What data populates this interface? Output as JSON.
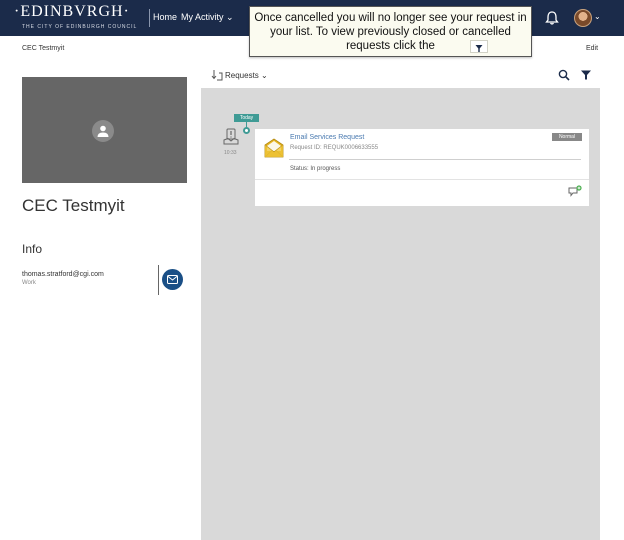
{
  "header": {
    "logo_text": "·EDINBVRGH·",
    "logo_subtext": "THE CITY OF EDINBURGH COUNCIL",
    "nav": {
      "home": "Home",
      "my_activity": "My Activity ⌄"
    },
    "avatar_caret": "⌄"
  },
  "tooltip": {
    "text": "Once cancelled you will no longer see your request in your list. To view previously closed or cancelled requests click the"
  },
  "subheader": {
    "profile_name": "CEC Testmyit",
    "edit": "Edit"
  },
  "profile": {
    "full_name": "CEC Testmyit",
    "info_heading": "Info",
    "email": "thomas.stratford@cgi.com",
    "email_type": "Work"
  },
  "requests": {
    "title": "Requests ⌄",
    "today_label": "Today",
    "time": "10:33",
    "card": {
      "title": "Email Services Request",
      "request_id": "Request ID: REQUK0006633555",
      "priority": "Normal",
      "status": "Status: In progress"
    }
  },
  "colors": {
    "header_bg": "#1b2b4a",
    "panel_bg": "#d9d9d9",
    "accent_teal": "#3f9b95",
    "link_blue": "#4a7ab0",
    "mail_button": "#1a4f86"
  }
}
